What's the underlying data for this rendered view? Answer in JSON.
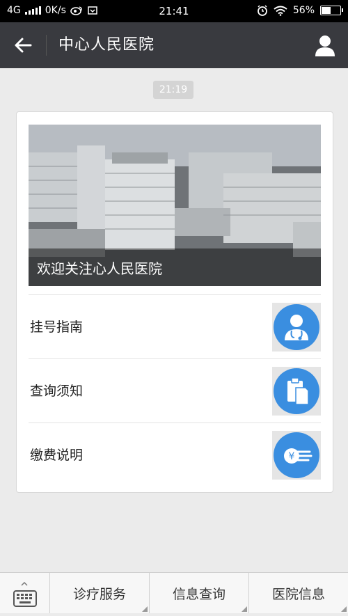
{
  "status_bar": {
    "network": "4G",
    "speed": "0K/s",
    "time": "21:41",
    "battery": "56%",
    "battery_level": 0.56
  },
  "header": {
    "title": "中心人民医院"
  },
  "chat": {
    "timestamp": "21:19"
  },
  "card": {
    "banner_caption": "欢迎关注心人民医院",
    "items": [
      {
        "label": "挂号指南",
        "icon": "doctor-icon"
      },
      {
        "label": "查询须知",
        "icon": "clipboard-icon"
      },
      {
        "label": "缴费说明",
        "icon": "yen-hand-icon"
      }
    ]
  },
  "bottom_menu": {
    "tabs": [
      {
        "label": "诊疗服务"
      },
      {
        "label": "信息查询"
      },
      {
        "label": "医院信息"
      }
    ]
  },
  "colors": {
    "header_bg": "#393a3f",
    "icon_blue": "#3a8ee0"
  }
}
